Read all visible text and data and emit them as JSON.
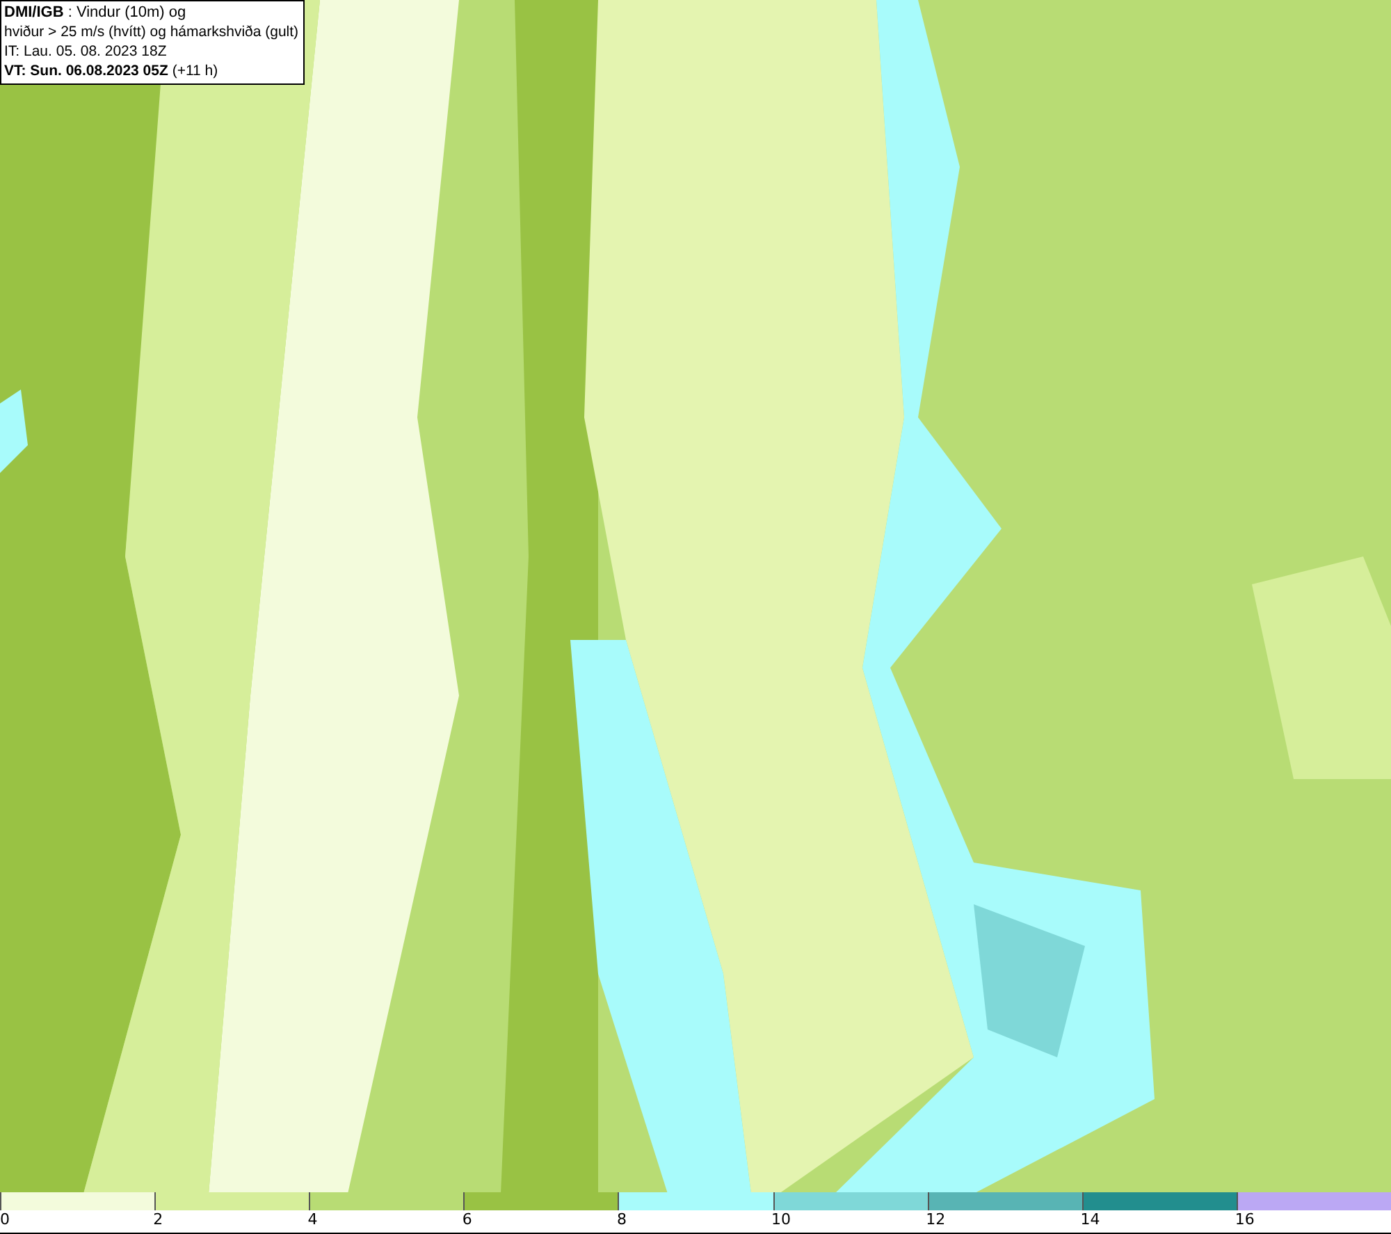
{
  "title_box": {
    "lines": [
      "**DMI/IGB** : Vindur (10m) og",
      "hviður > 25 m/s (hvítt) og hámarkshviða (gult)",
      "IT: Lau. 05. 08. 2023 18Z",
      "**VT: Sun. 06.08.2023 05Z** (+11 h)"
    ]
  },
  "legend": [
    {
      "label": "0",
      "color": "#f3fbdc"
    },
    {
      "label": "2",
      "color": "#d6ee9a"
    },
    {
      "label": "4",
      "color": "#b8dc74"
    },
    {
      "label": "6",
      "color": "#99c244"
    },
    {
      "label": "8",
      "color": "#a8fbfb"
    },
    {
      "label": "10",
      "color": "#7fd8d8"
    },
    {
      "label": "12",
      "color": "#58b4b4"
    },
    {
      "label": "14",
      "color": "#228e8e"
    },
    {
      "label": "16",
      "color": "#bba8f4"
    }
  ]
}
